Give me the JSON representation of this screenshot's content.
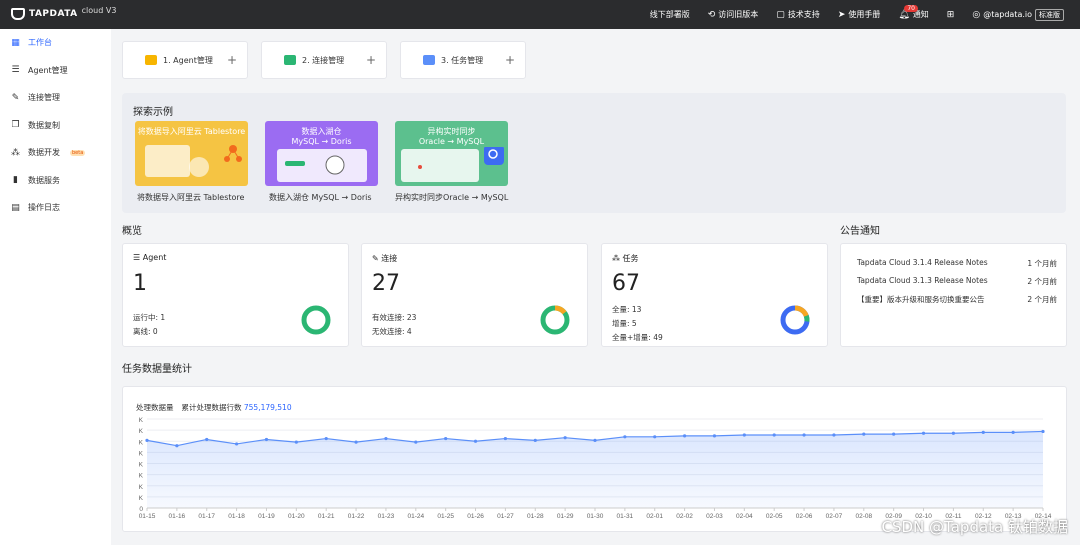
{
  "header": {
    "logo": "TAPDATA",
    "product": "cloud V3",
    "nav": [
      {
        "label": "线下部署版",
        "icon": "none"
      },
      {
        "label": "访问旧版本",
        "icon": "history-icon"
      },
      {
        "label": "技术支持",
        "icon": "support-icon"
      },
      {
        "label": "使用手册",
        "icon": "send-icon"
      },
      {
        "label": "通知",
        "icon": "bell-icon",
        "badge": "70"
      },
      {
        "label": "",
        "icon": "language-icon"
      }
    ],
    "user": "@tapdata.io",
    "plan": "标准版"
  },
  "sidebar": {
    "items": [
      {
        "label": "工作台",
        "icon": "dashboard-icon",
        "active": true
      },
      {
        "label": "Agent管理",
        "icon": "list-icon"
      },
      {
        "label": "连接管理",
        "icon": "link-icon"
      },
      {
        "label": "数据复制",
        "icon": "copy-icon"
      },
      {
        "label": "数据开发",
        "icon": "cluster-icon",
        "beta": "beta"
      },
      {
        "label": "数据服务",
        "icon": "bar-icon"
      },
      {
        "label": "操作日志",
        "icon": "log-icon"
      }
    ]
  },
  "quick": [
    {
      "label": "1. Agent管理",
      "color": "#f7b500"
    },
    {
      "label": "2. 连接管理",
      "color": "#2bb673"
    },
    {
      "label": "3. 任务管理",
      "color": "#5b8ff9"
    }
  ],
  "explore": {
    "title": "探索示例",
    "cards": [
      {
        "title": "将数据导入阿里云 Tablestore",
        "caption": "将数据导入阿里云 Tablestore",
        "color": "#f5c443"
      },
      {
        "title": "数据入湖仓\nMySQL → Doris",
        "caption": "数据入湖仓 MySQL → Doris",
        "color": "#9b6cf2"
      },
      {
        "title": "异构实时同步\nOracle → MySQL",
        "caption": "异构实时同步Oracle → MySQL",
        "color": "#5cc08e"
      }
    ]
  },
  "overview": {
    "title": "概览",
    "cards": [
      {
        "head": "Agent",
        "icon": "list-icon",
        "num": "1",
        "lines": [
          "运行中: 1",
          "离线: 0"
        ]
      },
      {
        "head": "连接",
        "icon": "link-icon",
        "num": "27",
        "lines": [
          "有效连接: 23",
          "无效连接: 4"
        ]
      },
      {
        "head": "任务",
        "icon": "cluster-icon",
        "num": "67",
        "lines": [
          "全量: 13",
          "增量: 5",
          "全量+增量: 49"
        ]
      }
    ]
  },
  "notice": {
    "title": "公告通知",
    "items": [
      {
        "text": "Tapdata Cloud 3.1.4 Release Notes",
        "time": "1 个月前"
      },
      {
        "text": "Tapdata Cloud 3.1.3 Release Notes",
        "time": "2 个月前"
      },
      {
        "text": "【重要】版本升级和服务切换重要公告",
        "time": "2 个月前"
      }
    ]
  },
  "stats": {
    "title": "任务数据量统计",
    "label": "处理数据量",
    "total_label": "累计处理数据行数",
    "total": "755,179,510"
  },
  "chart_data": {
    "type": "area",
    "x": [
      "01-15",
      "01-16",
      "01-17",
      "01-18",
      "01-19",
      "01-20",
      "01-21",
      "01-22",
      "01-23",
      "01-24",
      "01-25",
      "01-26",
      "01-27",
      "01-28",
      "01-29",
      "01-30",
      "01-31",
      "02-01",
      "02-02",
      "02-03",
      "02-04",
      "02-05",
      "02-06",
      "02-07",
      "02-08",
      "02-09",
      "02-10",
      "02-11",
      "02-12",
      "02-13",
      "02-14"
    ],
    "y_ticks": [
      "0",
      "K",
      "K",
      "K",
      "K",
      "K",
      "K",
      "K",
      "K"
    ],
    "values": [
      76,
      70,
      77,
      72,
      77,
      74,
      78,
      74,
      78,
      74,
      78,
      75,
      78,
      76,
      79,
      76,
      80,
      80,
      81,
      81,
      82,
      82,
      82,
      82,
      83,
      83,
      84,
      84,
      85,
      85,
      86
    ],
    "ylim": [
      0,
      100
    ],
    "color": "#5b8ff9",
    "grid": true
  },
  "watermark": "CSDN @Tapdata 钛铂数据"
}
